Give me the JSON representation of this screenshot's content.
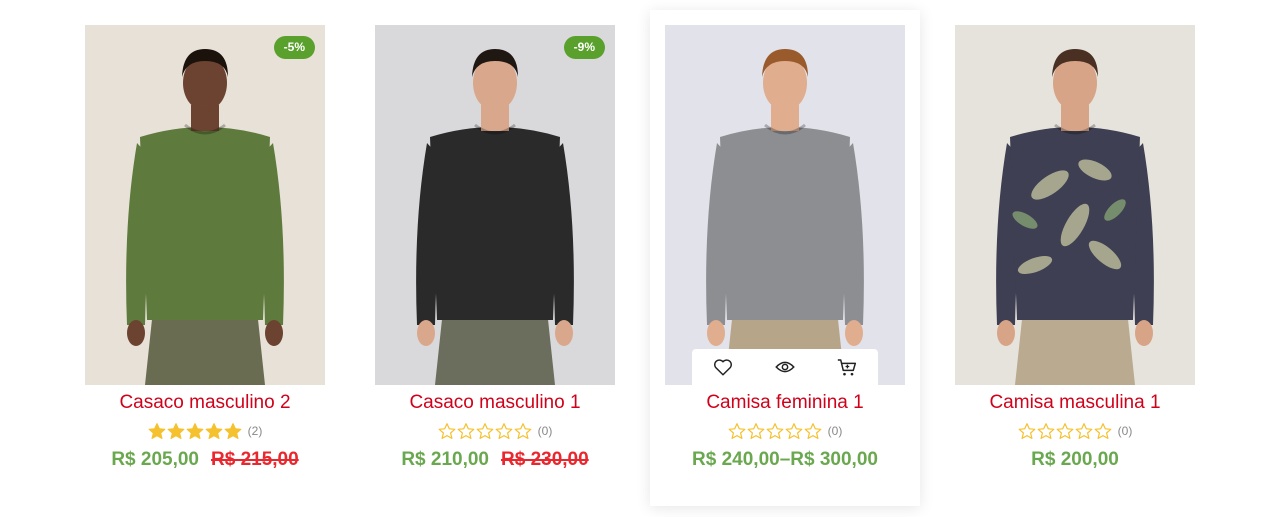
{
  "products": [
    {
      "title": "Casaco masculino 2",
      "badge": "-5%",
      "rating_filled": 5,
      "review_count": "(2)",
      "price": "R$ 205,00",
      "old_price": "R$ 215,00",
      "image": {
        "bg": "#e7e1d8",
        "skin": "#6b4330",
        "shirt": "#5e7a3c",
        "pants": "#6a6c52",
        "hair": "#1c120c",
        "desc": "man-green-sweater"
      }
    },
    {
      "title": "Casaco masculino 1",
      "badge": "-9%",
      "rating_filled": 0,
      "review_count": "(0)",
      "price": "R$ 210,00",
      "old_price": "R$ 230,00",
      "image": {
        "bg": "#d9d9dc",
        "skin": "#d9a88c",
        "shirt": "#2a2a2a",
        "pants": "#6b6e5c",
        "hair": "#1f1712",
        "desc": "man-black-sweater"
      }
    },
    {
      "title": "Camisa feminina 1",
      "badge": "",
      "rating_filled": 0,
      "review_count": "(0)",
      "price": "R$ 240,00–R$ 300,00",
      "old_price": "",
      "image": {
        "bg": "#e2e2ea",
        "skin": "#e0ad8e",
        "shirt": "#8c8e92",
        "pants": "#b7a58a",
        "hair": "#9a5b2c",
        "desc": "man-gray-shirt"
      }
    },
    {
      "title": "Camisa masculina 1",
      "badge": "",
      "rating_filled": 0,
      "review_count": "(0)",
      "price": "R$ 200,00",
      "old_price": "",
      "image": {
        "bg": "#e6e3dd",
        "skin": "#d7a487",
        "shirt": "#3e3f52",
        "pants": "#b9aa90",
        "hair": "#4a3022",
        "desc": "man-floral-shirt"
      }
    }
  ],
  "colors": {
    "title": "#d0021b",
    "price": "#6aa84f",
    "old_price": "#e8282e",
    "badge": "#5aa02c",
    "star": "#f5c12e"
  },
  "hover_actions": [
    "heart-icon",
    "eye-icon",
    "cart-icon"
  ]
}
